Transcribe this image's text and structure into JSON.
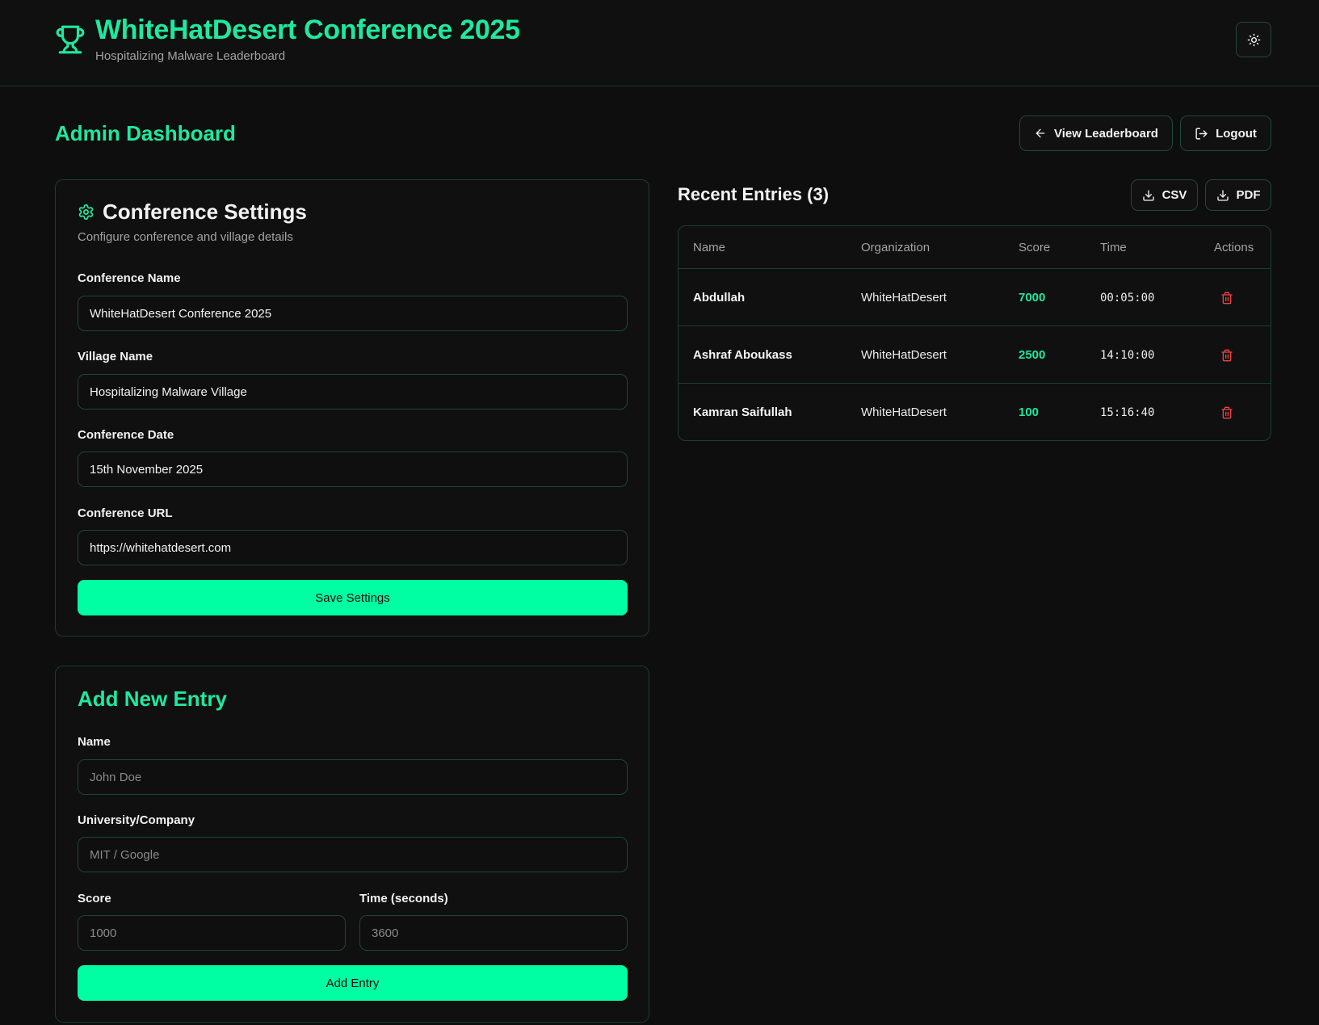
{
  "header": {
    "title": "WhiteHatDesert Conference 2025",
    "subtitle": "Hospitalizing Malware Leaderboard"
  },
  "page": {
    "title": "Admin Dashboard",
    "view_leaderboard_label": "View Leaderboard",
    "logout_label": "Logout"
  },
  "settings": {
    "title": "Conference Settings",
    "description": "Configure conference and village details",
    "fields": {
      "conference_name": {
        "label": "Conference Name",
        "value": "WhiteHatDesert Conference 2025"
      },
      "village_name": {
        "label": "Village Name",
        "value": "Hospitalizing Malware Village"
      },
      "conference_date": {
        "label": "Conference Date",
        "value": "15th November 2025"
      },
      "conference_url": {
        "label": "Conference URL",
        "value": "https://whitehatdesert.com"
      }
    },
    "save_label": "Save Settings"
  },
  "add_entry": {
    "title": "Add New Entry",
    "fields": {
      "name": {
        "label": "Name",
        "placeholder": "John Doe"
      },
      "organization": {
        "label": "University/Company",
        "placeholder": "MIT / Google"
      },
      "score": {
        "label": "Score",
        "placeholder": "1000"
      },
      "time": {
        "label": "Time (seconds)",
        "placeholder": "3600"
      }
    },
    "submit_label": "Add Entry"
  },
  "entries": {
    "title": "Recent Entries (3)",
    "csv_label": "CSV",
    "pdf_label": "PDF",
    "columns": {
      "name": "Name",
      "organization": "Organization",
      "score": "Score",
      "time": "Time",
      "actions": "Actions"
    },
    "rows": [
      {
        "name": "Abdullah",
        "organization": "WhiteHatDesert",
        "score": "7000",
        "time": "00:05:00"
      },
      {
        "name": "Ashraf Aboukass",
        "organization": "WhiteHatDesert",
        "score": "2500",
        "time": "14:10:00"
      },
      {
        "name": "Kamran Saifullah",
        "organization": "WhiteHatDesert",
        "score": "100",
        "time": "15:16:40"
      }
    ]
  },
  "icons": {
    "header_logo": "trophy-icon",
    "theme_toggle": "sun-icon",
    "back": "arrow-left-icon",
    "logout": "logout-icon",
    "settings": "gear-icon",
    "export": "download-icon",
    "delete": "trash-icon"
  },
  "colors": {
    "accent": "#1de9a0",
    "primary_button": "#00ffa3",
    "background": "#0e0e0e",
    "border": "#173f32",
    "danger": "#ef4444"
  }
}
